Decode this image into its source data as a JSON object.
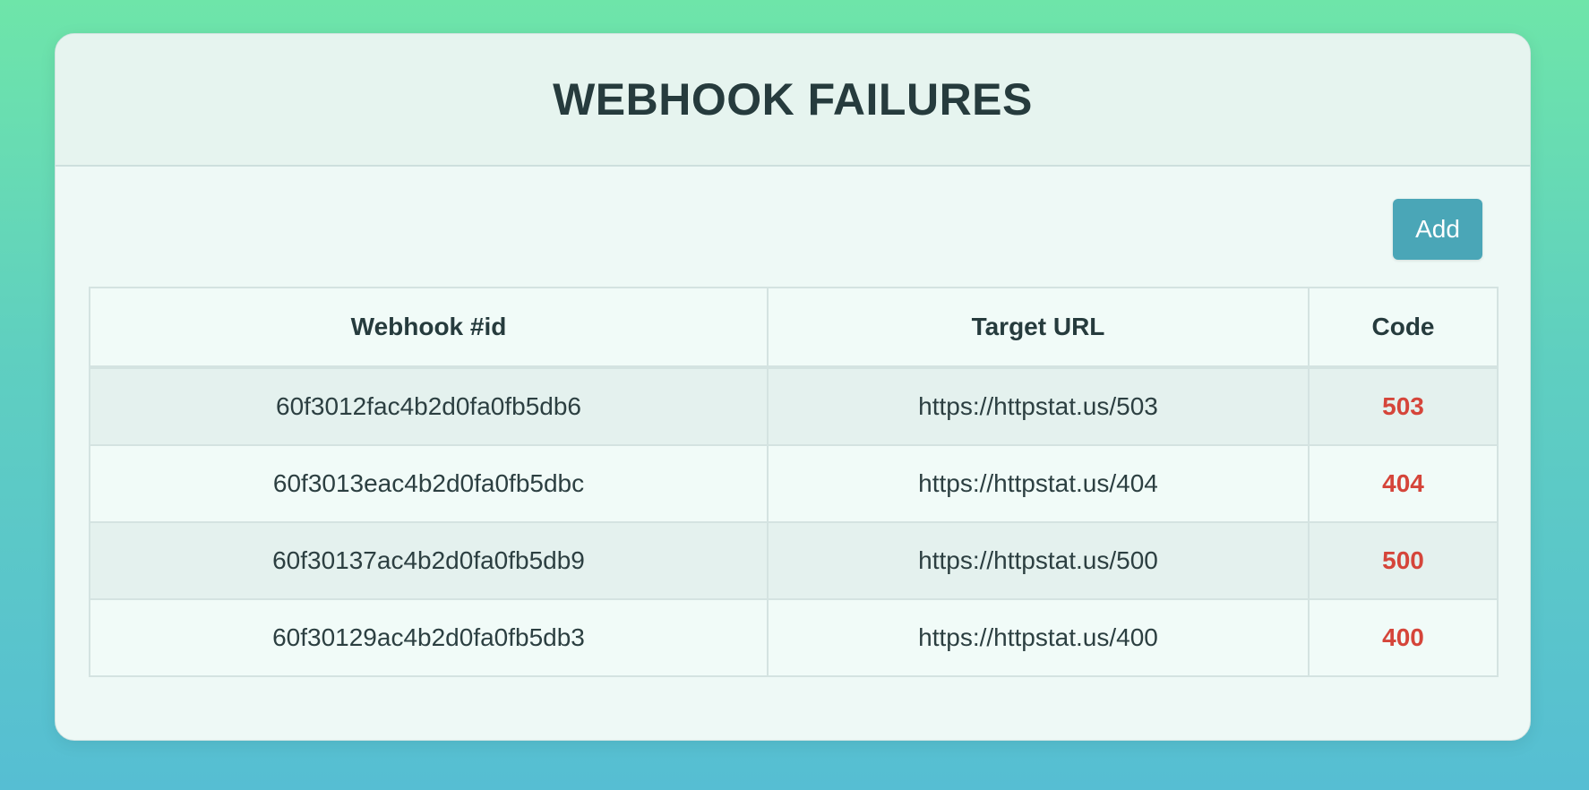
{
  "page": {
    "title": "WEBHOOK FAILURES"
  },
  "toolbar": {
    "add_label": "Add"
  },
  "table": {
    "headers": [
      "Webhook #id",
      "Target URL",
      "Code"
    ],
    "rows": [
      {
        "id": "60f3012fac4b2d0fa0fb5db6",
        "url": "https://httpstat.us/503",
        "code": "503"
      },
      {
        "id": "60f3013eac4b2d0fa0fb5dbc",
        "url": "https://httpstat.us/404",
        "code": "404"
      },
      {
        "id": "60f30137ac4b2d0fa0fb5db9",
        "url": "https://httpstat.us/500",
        "code": "500"
      },
      {
        "id": "60f30129ac4b2d0fa0fb5db3",
        "url": "https://httpstat.us/400",
        "code": "400"
      }
    ]
  },
  "colors": {
    "accent": "#4aa6b7",
    "error": "#d5453a",
    "text": "#263b3d"
  }
}
